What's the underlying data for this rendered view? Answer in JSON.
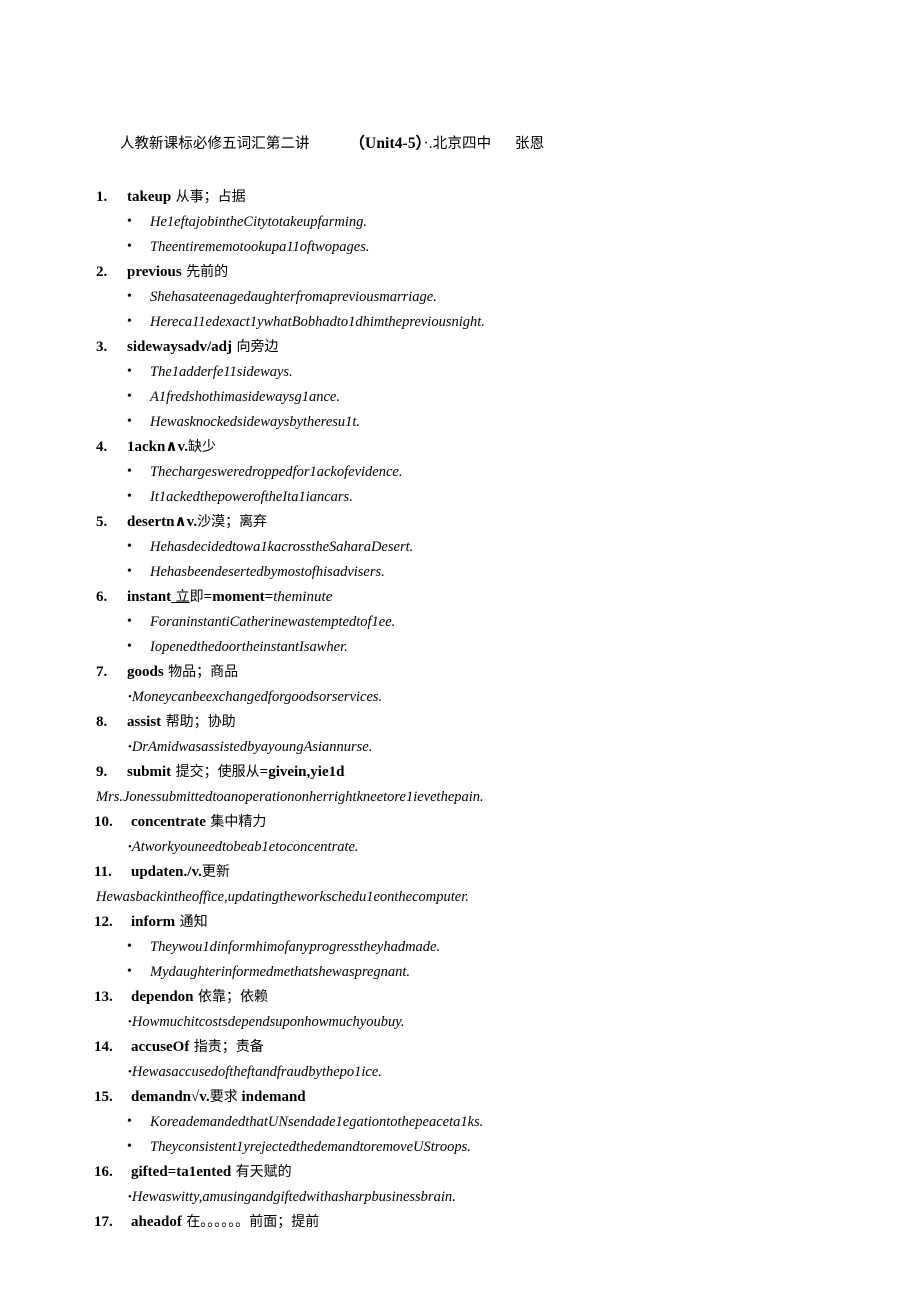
{
  "document": {
    "header": {
      "title_cn": "人教新课标必修五词汇第二讲",
      "gap": "          ",
      "unit": "（Unit4-5）",
      "marks": "·.",
      "school": "北京四中",
      "gap2": "      ",
      "author": "张恩"
    },
    "entries": [
      {
        "num": "1.",
        "term": "takeup",
        "gloss": " 从事；占据",
        "examples": [
          {
            "style": "bullet",
            "text": "He1eftajobintheCitytotakeupfarming."
          },
          {
            "style": "bullet",
            "text": "Theentirememotookupa11oftwopages."
          }
        ]
      },
      {
        "num": "2.",
        "term": "previous",
        "gloss": " 先前的",
        "examples": [
          {
            "style": "bullet",
            "text": "Shehasateenagedaughterfromapreviousmarriage."
          },
          {
            "style": "bullet",
            "text": "Hereca11edexact1ywhatBobhadto1dhimthepreviousnight."
          }
        ]
      },
      {
        "num": "3.",
        "term": "sidewaysadv/adj",
        "gloss": " 向旁边",
        "examples": [
          {
            "style": "bullet",
            "text": "The1adderfe11sideways."
          },
          {
            "style": "bullet",
            "text": "A1fredshothimasidewaysg1ance."
          },
          {
            "style": "bullet",
            "text": "Hewasknockedsidewaysbytheresu1t."
          }
        ]
      },
      {
        "num": "4.",
        "term": "1ackn∧v.",
        "gloss": "缺少",
        "examples": [
          {
            "style": "bullet",
            "text": "Thechargesweredroppedfor1ackofevidence."
          },
          {
            "style": "bullet",
            "text": "It1ackedthepoweroftheIta1iancars."
          }
        ]
      },
      {
        "num": "5.",
        "term": "desertn∧v.",
        "gloss": "沙漠；离弃",
        "examples": [
          {
            "style": "bullet",
            "text": "Hehasdecidedtowa1kacrosstheSaharaDesert."
          },
          {
            "style": "bullet",
            "text": "Hehasbeendesertedbymostofhisadvisers."
          }
        ]
      },
      {
        "num": "6.",
        "term": "instant",
        "gloss_underlined": "立",
        "gloss": "即",
        "equals_bold": "=moment=",
        "equals_italic": "theminute",
        "examples": [
          {
            "style": "bullet",
            "text": "ForaninstantiCatherinewastemptedtof1ee."
          },
          {
            "style": "bullet",
            "text": "IopenedthedoortheinstantIsawher."
          }
        ]
      },
      {
        "num": "7.",
        "term": "goods",
        "gloss": " 物品；商品",
        "examples": [
          {
            "style": "inline",
            "text": "Moneycanbeexchangedforgoodsorservices."
          }
        ]
      },
      {
        "num": "8.",
        "term": "assist",
        "gloss": " 帮助；协助",
        "examples": [
          {
            "style": "inline",
            "text": "DrAmidwasassistedbyayoungAsiannurse."
          }
        ]
      },
      {
        "num": "9.",
        "term": "submit",
        "gloss": " 提交；使服从",
        "term_tail": "=givein,yie1d",
        "examples": [
          {
            "style": "flush",
            "text": "Mrs.Jonessubmittedtoanoperationonherrightkneetore1ievethepain."
          }
        ]
      },
      {
        "num": "10.",
        "term": "concentrate",
        "gloss": " 集中精力",
        "examples": [
          {
            "style": "inline",
            "text": "Atworkyouneedtobeab1etoconcentrate."
          }
        ]
      },
      {
        "num": "11.",
        "term": "updaten./v.",
        "gloss": "更新",
        "examples": [
          {
            "style": "flush",
            "text": "Hewasbackintheoffice,updatingtheworkschedu1eonthecomputer."
          }
        ]
      },
      {
        "num": "12.",
        "term": "inform",
        "gloss": " 通知",
        "examples": [
          {
            "style": "bullet",
            "text": "Theywou1dinformhimofanyprogresstheyhadmade."
          },
          {
            "style": "bullet",
            "text": "Mydaughterinformedmethatshewaspregnant."
          }
        ]
      },
      {
        "num": "13.",
        "term": "dependon",
        "gloss": " 依靠；依赖",
        "examples": [
          {
            "style": "inline",
            "text": "Howmuchitcostsdependsuponhowmuchyoubuy."
          }
        ]
      },
      {
        "num": "14.",
        "term": "accuseOf",
        "gloss": " 指责；责备",
        "examples": [
          {
            "style": "inline",
            "text": "Hewasaccusedoftheftandfraudbythepo1ice."
          }
        ]
      },
      {
        "num": "15.",
        "term": "demandn√v.",
        "gloss": "要求",
        "term_tail": " indemand",
        "examples": [
          {
            "style": "bullet",
            "text": "KoreademandedthatUNsendade1egationtothepeaceta1ks."
          },
          {
            "style": "bullet",
            "text": "Theyconsistent1yrejectedthedemandtoremoveUStroops."
          }
        ]
      },
      {
        "num": "16.",
        "term": "gifted=ta1ented",
        "gloss": " 有天赋的",
        "examples": [
          {
            "style": "inline",
            "text": "Hewaswitty,amusingandgiftedwithasharpbusinessbrain."
          }
        ]
      },
      {
        "num": "17.",
        "term": "aheadof",
        "gloss": " 在。。。。。。前面；提前",
        "examples": []
      }
    ],
    "bullet_glyph": "•"
  }
}
